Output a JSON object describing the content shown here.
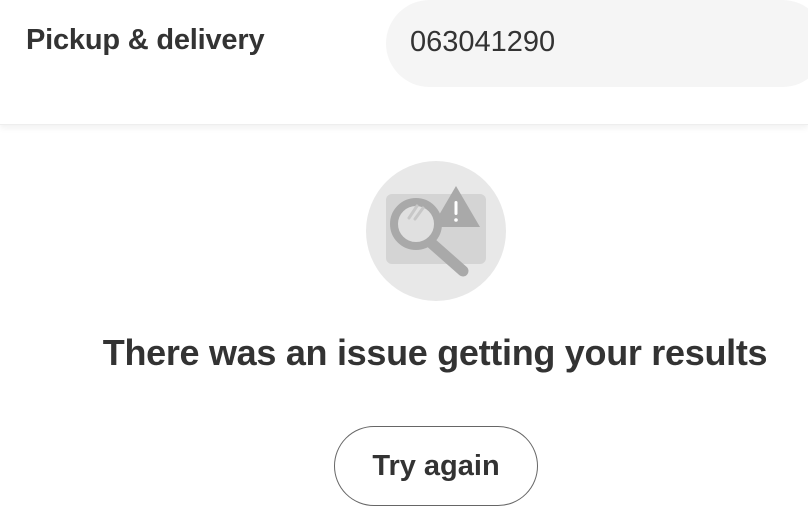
{
  "header": {
    "title": "Pickup & delivery",
    "search_value": "063041290"
  },
  "error": {
    "illustration_icon": "search-warning-icon",
    "message": "There was an issue getting your results",
    "retry_label": "Try again"
  },
  "colors": {
    "text": "#333333",
    "search_background": "#f5f5f5",
    "illustration_circle": "#e8e8e8",
    "illustration_detail": "#a9a9a9",
    "button_border": "#666666"
  }
}
